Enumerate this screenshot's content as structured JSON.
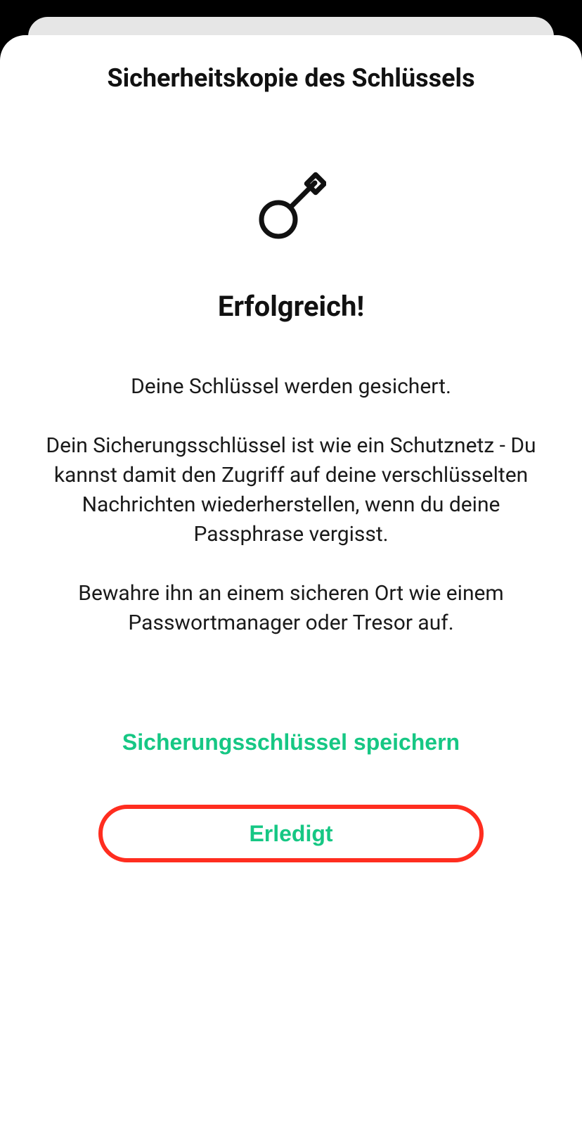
{
  "header": {
    "title": "Sicherheitskopie des Schlüssels"
  },
  "content": {
    "success_heading": "Erfolgreich!",
    "body_text": "Deine Schlüssel werden gesichert.\n\nDein Sicherungsschlüssel ist wie ein Schutznetz - Du kannst damit den Zugriff auf deine verschlüsselten Nachrichten wiederherstellen, wenn du deine Passphrase vergisst.\n\nBewahre ihn an einem sicheren Ort wie einem Passwortmanager oder Tresor auf."
  },
  "actions": {
    "save_key_label": "Sicherungsschlüssel speichern",
    "done_label": "Erledigt"
  },
  "colors": {
    "accent": "#16c784",
    "highlight_border": "#ff2d1f"
  }
}
